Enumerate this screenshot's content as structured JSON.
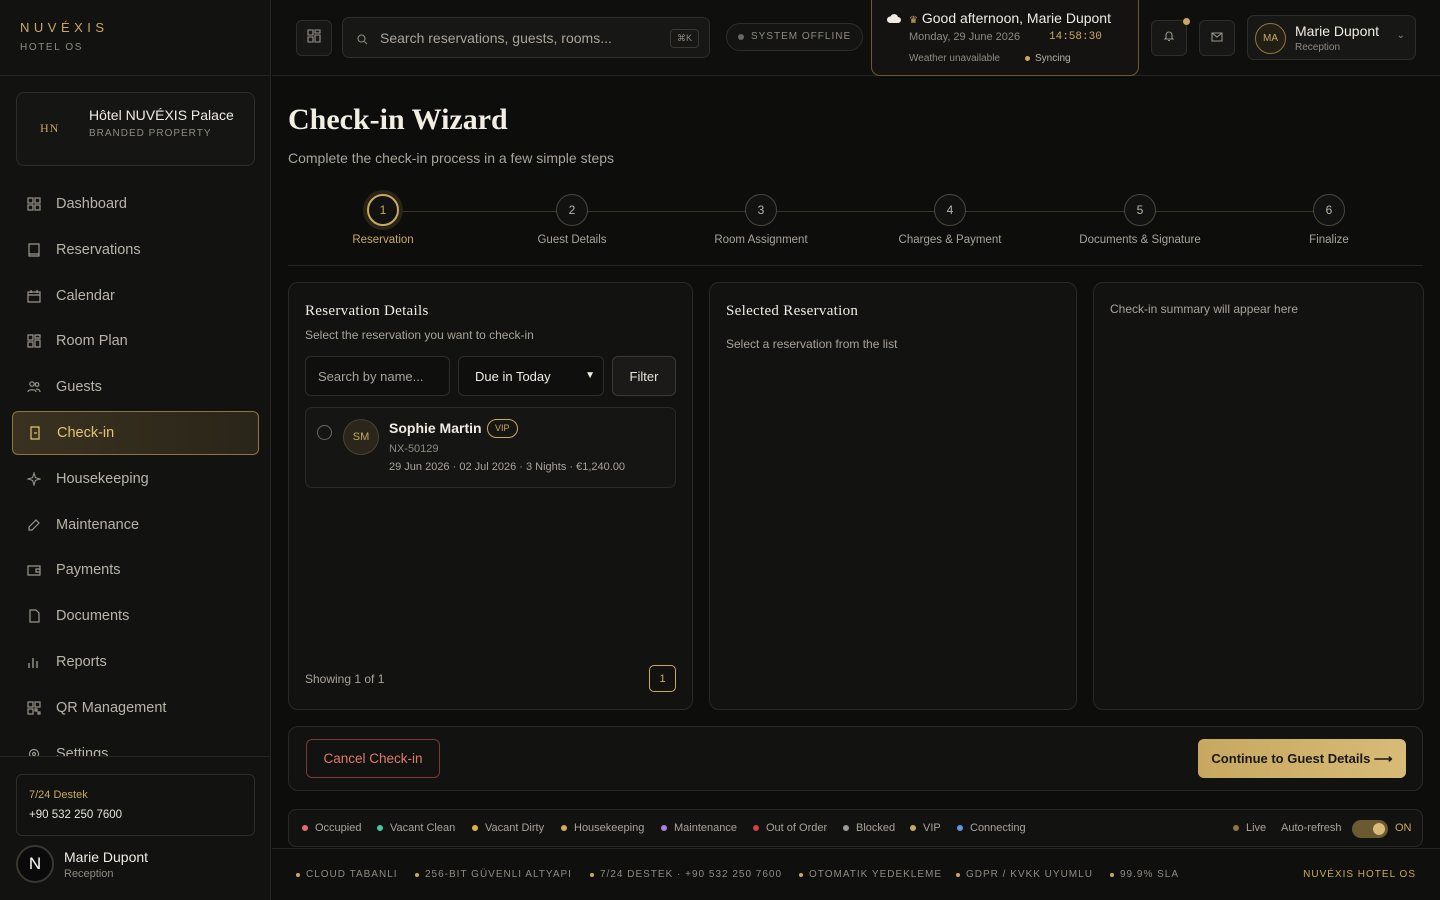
{
  "brand": {
    "name": "NUVÉXIS",
    "sub": "HOTEL OS"
  },
  "property": {
    "initials": "HN",
    "name": "Hôtel NUVÉXIS Palace",
    "type": "BRANDED PROPERTY"
  },
  "nav": [
    {
      "label": "Dashboard",
      "icon": "grid-icon"
    },
    {
      "label": "Reservations",
      "icon": "book-icon"
    },
    {
      "label": "Calendar",
      "icon": "calendar-icon"
    },
    {
      "label": "Room Plan",
      "icon": "layout-icon"
    },
    {
      "label": "Guests",
      "icon": "users-icon"
    },
    {
      "label": "Check-in",
      "icon": "checkin-icon",
      "active": true
    },
    {
      "label": "Housekeeping",
      "icon": "sparkle-icon"
    },
    {
      "label": "Maintenance",
      "icon": "wrench-icon"
    },
    {
      "label": "Payments",
      "icon": "wallet-icon"
    },
    {
      "label": "Documents",
      "icon": "file-icon"
    },
    {
      "label": "Reports",
      "icon": "bar-chart-icon"
    },
    {
      "label": "QR Management",
      "icon": "qr-icon"
    },
    {
      "label": "Settings",
      "icon": "gear-icon"
    }
  ],
  "support": {
    "title": "7/24 Destek",
    "phone": "+90 532 250 7600"
  },
  "sidebar_user": {
    "initial": "N",
    "name": "Marie Dupont",
    "role": "Reception"
  },
  "topbar": {
    "search_placeholder": "Search reservations, guests, rooms...",
    "shortcut": "⌘K",
    "status": "SYSTEM OFFLINE",
    "greeting": "Good afternoon, Marie Dupont",
    "date": "Monday, 29 June 2026",
    "time": "14:58:30",
    "weather": "Weather unavailable",
    "sync": "Syncing",
    "user_initials": "MA",
    "user_name": "Marie Dupont",
    "user_role": "Reception"
  },
  "page": {
    "title": "Check-in Wizard",
    "subtitle": "Complete the check-in process in a few simple steps"
  },
  "steps": [
    {
      "num": "1",
      "label": "Reservation",
      "active": true
    },
    {
      "num": "2",
      "label": "Guest Details"
    },
    {
      "num": "3",
      "label": "Room Assignment"
    },
    {
      "num": "4",
      "label": "Charges & Payment"
    },
    {
      "num": "5",
      "label": "Documents & Signature"
    },
    {
      "num": "6",
      "label": "Finalize"
    }
  ],
  "details": {
    "title": "Reservation Details",
    "subtitle": "Select the reservation you want to check-in",
    "search_placeholder": "Search by name...",
    "filter_select": "Due in Today",
    "filter_button": "Filter",
    "reservation": {
      "initials": "SM",
      "name": "Sophie Martin",
      "badge": "VIP",
      "id": "NX-50129",
      "meta": "29 Jun 2026 · 02 Jul 2026 · 3 Nights · €1,240.00"
    },
    "showing": "Showing 1 of 1",
    "page": "1"
  },
  "selected": {
    "title": "Selected Reservation",
    "empty": "Select a reservation from the list"
  },
  "summary": {
    "empty": "Check-in summary will appear here"
  },
  "actions": {
    "cancel": "Cancel Check-in",
    "continue": "Continue to Guest Details ⟶"
  },
  "legend": [
    {
      "label": "Occupied",
      "color": "#e26d6d"
    },
    {
      "label": "Vacant Clean",
      "color": "#3fc9a0"
    },
    {
      "label": "Vacant Dirty",
      "color": "#e0b341"
    },
    {
      "label": "Housekeeping",
      "color": "#d4a95c"
    },
    {
      "label": "Maintenance",
      "color": "#b07ae0"
    },
    {
      "label": "Out of Order",
      "color": "#d9413f"
    },
    {
      "label": "Blocked",
      "color": "#9a9a9a"
    },
    {
      "label": "VIP",
      "color": "#c9a961"
    },
    {
      "label": "Connecting",
      "color": "#5b9ae8"
    }
  ],
  "live": {
    "label": "Live",
    "auto": "Auto-refresh",
    "state": "ON"
  },
  "footer": {
    "items": [
      "CLOUD TABANLI",
      "256-BIT GÜVENLI ALTYAPI",
      "7/24 DESTEK · +90 532 250 7600",
      "OTOMATIK YEDEKLEME",
      "GDPR / KVKK UYUMLU",
      "99.9% SLA"
    ],
    "brand": "NUVÉXIS HOTEL OS"
  },
  "colors": {
    "accent": "#c9a961",
    "danger": "#e07a6a",
    "bg": "#0d0d0c"
  }
}
